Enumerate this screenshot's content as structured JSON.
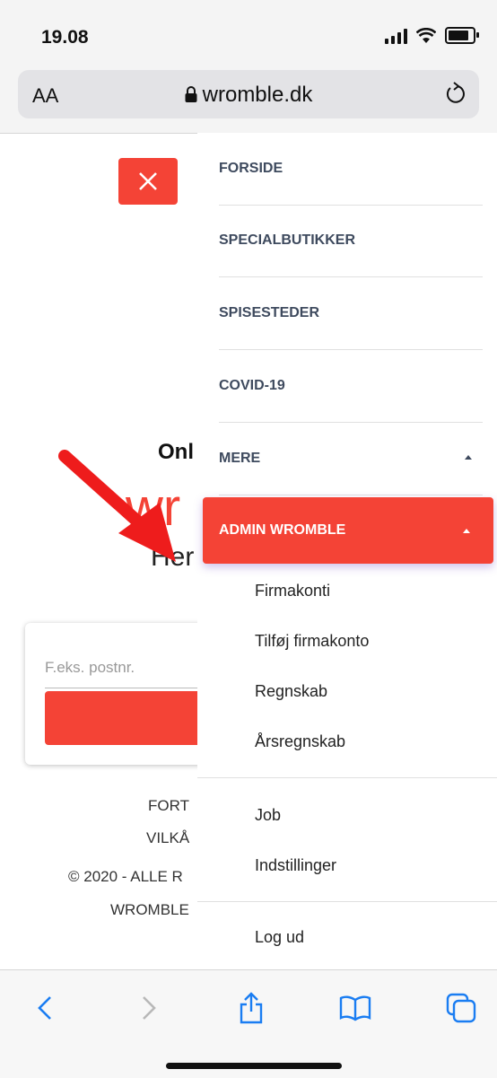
{
  "status": {
    "time": "19.08"
  },
  "browser": {
    "text_size": "AA",
    "url": "wromble.dk"
  },
  "page": {
    "online": "Onl",
    "brand": "wr",
    "hero_sub": "Her",
    "search_placeholder": "F.eks. postnr.",
    "footer": [
      "FORT",
      "VILKÅ",
      "© 2020 - ALLE R",
      "WROMBLE"
    ]
  },
  "menu": {
    "items": [
      "FORSIDE",
      "SPECIALBUTIKKER",
      "SPISESTEDER",
      "COVID-19",
      "MERE"
    ],
    "admin_label": "ADMIN WROMBLE",
    "admin_sub": [
      "Firmakonti",
      "Tilføj firmakonto",
      "Regnskab",
      "Årsregnskab"
    ],
    "more_sub": [
      "Job",
      "Indstillinger"
    ],
    "logout": "Log ud"
  },
  "colors": {
    "accent": "#f44336",
    "menu_text": "#3e4a5e",
    "ios_blue": "#1a7df2"
  },
  "icons": [
    "signal-icon",
    "wifi-icon",
    "battery-icon",
    "lock-icon",
    "reload-icon",
    "close-icon",
    "back-icon",
    "forward-icon",
    "share-icon",
    "bookmarks-icon",
    "tabs-icon"
  ]
}
